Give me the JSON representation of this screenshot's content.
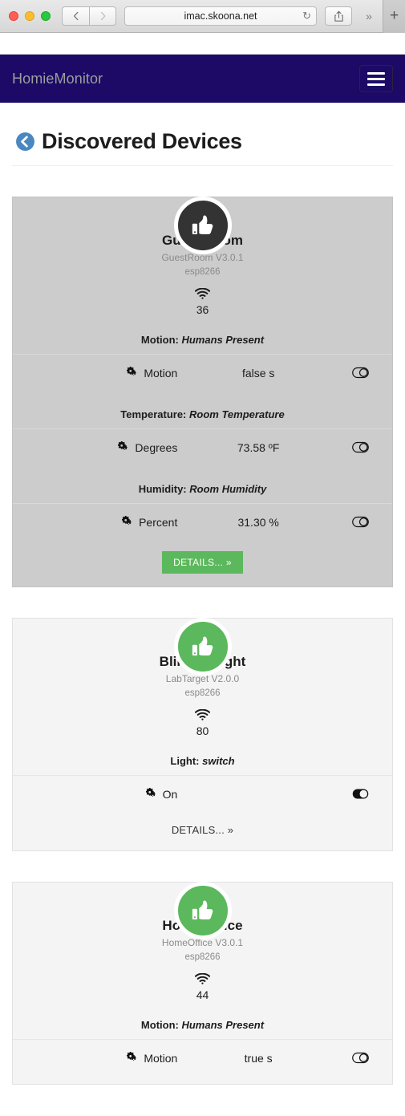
{
  "browser": {
    "url": "imac.skoona.net",
    "back_icon": "chevron-left-icon",
    "forward_icon": "chevron-right-icon",
    "reload_glyph": "↻",
    "share_icon": "share-icon",
    "overflow_glyph": "»",
    "newtab_glyph": "+"
  },
  "navbar": {
    "brand": "HomieMonitor",
    "brand_color": "#9d9d9d",
    "background": "#1c0a66",
    "menu_icon": "hamburger-menu-icon"
  },
  "page": {
    "title": "Discovered Devices",
    "back_icon": "back-arrow-circle-icon",
    "back_color": "#4a87c0"
  },
  "icons": {
    "status": "thumbs-up-icon",
    "signal": "wifi-icon",
    "property": "cogs-icon",
    "toggle_off": "toggle-off-icon",
    "toggle_on": "toggle-on-icon"
  },
  "devices": [
    {
      "status_color": "#333333",
      "theme": "dark",
      "name": "Guest Room",
      "firmware": "GuestRoom V3.0.1",
      "chip": "esp8266",
      "signal": "36",
      "nodes": [
        {
          "label_prefix": "Motion:",
          "label_name": "Humans Present",
          "properties": [
            {
              "name": "Motion",
              "value": "false s",
              "toggle": "toggle-off-icon",
              "toggle_state": "off"
            }
          ]
        },
        {
          "label_prefix": "Temperature:",
          "label_name": "Room Temperature",
          "properties": [
            {
              "name": "Degrees",
              "value": "73.58 ºF",
              "toggle": "toggle-off-icon",
              "toggle_state": "off"
            }
          ]
        },
        {
          "label_prefix": "Humidity:",
          "label_name": "Room Humidity",
          "properties": [
            {
              "name": "Percent",
              "value": "31.30 %",
              "toggle": "toggle-off-icon",
              "toggle_state": "off"
            }
          ]
        }
      ],
      "footer": {
        "style": "button",
        "label": "DETAILS... »",
        "color": "#5cb85c"
      }
    },
    {
      "status_color": "#5cb85c",
      "theme": "light",
      "name": "Blinking light",
      "firmware": "LabTarget V2.0.0",
      "chip": "esp8266",
      "signal": "80",
      "nodes": [
        {
          "label_prefix": "Light:",
          "label_name": "switch",
          "properties": [
            {
              "name": "On",
              "value": "",
              "toggle": "toggle-on-icon",
              "toggle_state": "on"
            }
          ]
        }
      ],
      "footer": {
        "style": "link",
        "label": "DETAILS... »",
        "color": "#333333"
      }
    },
    {
      "status_color": "#5cb85c",
      "theme": "light",
      "name": "Home Office",
      "firmware": "HomeOffice V3.0.1",
      "chip": "esp8266",
      "signal": "44",
      "nodes": [
        {
          "label_prefix": "Motion:",
          "label_name": "Humans Present",
          "properties": [
            {
              "name": "Motion",
              "value": "true s",
              "toggle": "toggle-off-icon",
              "toggle_state": "off"
            }
          ]
        }
      ],
      "footer": null
    }
  ]
}
